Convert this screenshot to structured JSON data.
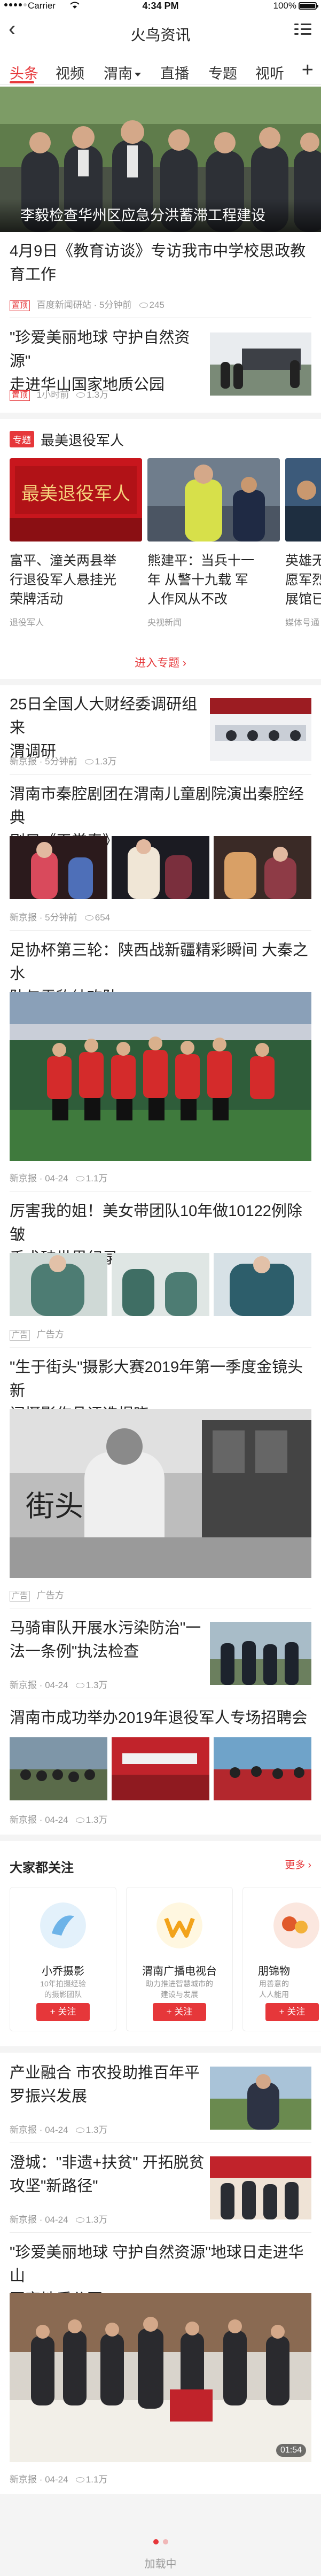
{
  "status_bar": {
    "carrier": "Carrier",
    "time": "4:34 PM",
    "battery": "100%"
  },
  "nav": {
    "title": "火鸟资讯"
  },
  "tabs": [
    "头条",
    "视频",
    "渭南",
    "直播",
    "专题",
    "视听"
  ],
  "hero": {
    "caption": "李毅检查华州区应急分洪蓄滞工程建设"
  },
  "feed": [
    {
      "title_lines": [
        "4月9日《教育访谈》专访我市中学校思政教",
        "育工作"
      ],
      "tag": "置顶",
      "source": "百度新闻研站",
      "time": "5分钟前",
      "views": "245"
    },
    {
      "title_lines": [
        "\"珍爱美丽地球 守护自然资源\"",
        "走进华山国家地质公园"
      ],
      "tag": "置顶",
      "source": "",
      "time": "1小时前",
      "views": "1.3万"
    }
  ],
  "topic": {
    "badge": "专题",
    "name": "最美退役军人",
    "cards": [
      {
        "title_lines": [
          "富平、潼关两县举",
          "行退役军人悬挂光",
          "荣牌活动"
        ],
        "source": "退役军人"
      },
      {
        "title_lines": [
          "熊建平：当兵十一",
          "年 从警十九载 军",
          "人作风从不改"
        ],
        "source": "央视新闻"
      },
      {
        "title_lines": [
          "英雄无",
          "愿军烈",
          "展馆已"
        ],
        "source": "媒体号通"
      }
    ],
    "enter_label": "进入专题"
  },
  "feed2": [
    {
      "title_lines": [
        "25日全国人大财经委调研组来",
        "渭调研"
      ],
      "source": "新京报",
      "time": "5分钟前",
      "views": "1.3万"
    },
    {
      "title_lines": [
        "渭南市秦腔剧团在渭南儿童剧院演出秦腔经典",
        "剧目《玉堂春》"
      ],
      "source": "新京报",
      "time": "5分钟前",
      "views": "654"
    },
    {
      "title_lines": [
        "足协杯第三轮：陕西战新疆精彩瞬间 大秦之水",
        "队与雪豹纳欢队"
      ],
      "source": "新京报",
      "time": "04-24",
      "views": "1.1万"
    },
    {
      "title_lines": [
        "厉害我的姐！美女带团队10年做10122例除皱",
        "手术破世界纪录"
      ],
      "tag": "广告",
      "source": "广告方"
    },
    {
      "title_lines": [
        "\"生于街头\"摄影大赛2019年第一季度金镜头新",
        "闻摄影作品评选揭晓"
      ],
      "tag": "广告",
      "source": "广告方"
    },
    {
      "title_lines": [
        "马骑审队开展水污染防治\"一",
        "法一条例\"执法检查"
      ],
      "source": "新京报",
      "time": "04-24",
      "views": "1.3万"
    },
    {
      "title_lines": [
        "渭南市成功举办2019年退役军人专场招聘会"
      ],
      "source": "新京报",
      "time": "04-24",
      "views": "1.3万"
    }
  ],
  "follow": {
    "heading": "大家都关注",
    "more": "更多",
    "cards": [
      {
        "name": "小乔摄影",
        "desc_lines": [
          "10年拍摄经验",
          "的摄影团队"
        ],
        "button": "+ 关注"
      },
      {
        "name": "渭南广播电视台",
        "desc_lines": [
          "助力推进智慧城市的",
          "建设与发展"
        ],
        "button": "+ 关注"
      },
      {
        "name": "朋锦物",
        "desc_lines": [
          "用善意的",
          "人人能用"
        ],
        "button": "+ 关注"
      }
    ]
  },
  "feed3": [
    {
      "title_lines": [
        "产业融合 市农投助推百年平",
        "罗振兴发展"
      ],
      "source": "新京报",
      "time": "04-24",
      "views": "1.3万"
    },
    {
      "title_lines": [
        "澄城：\"非遗+扶贫\" 开拓脱贫",
        "攻坚\"新路径\""
      ],
      "source": "新京报",
      "time": "04-24",
      "views": "1.3万"
    },
    {
      "title_lines": [
        "\"珍爱美丽地球 守护自然资源\"地球日走进华山",
        "国家地质公园"
      ],
      "source": "新京报",
      "time": "04-24",
      "views": "1.1万",
      "duration": "01:54"
    }
  ],
  "footer": {
    "loading": "加载中"
  },
  "colors": {
    "accent": "#e6373a",
    "meta": "#999999",
    "divider": "#ececec"
  }
}
